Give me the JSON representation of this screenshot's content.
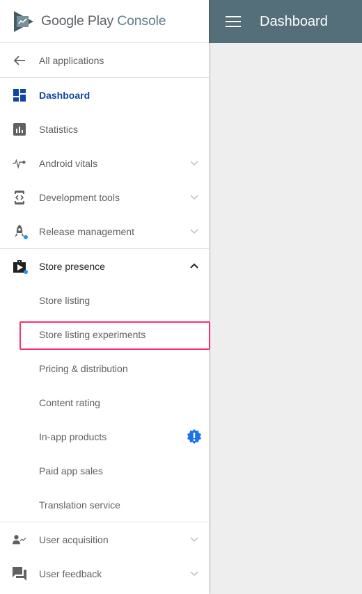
{
  "brand": {
    "google_play": "Google Play",
    "console": "Console"
  },
  "topbar": {
    "title": "Dashboard",
    "menu_icon": "hamburger-menu-icon"
  },
  "colors": {
    "topbar": "#546e7a",
    "active": "#0d47a1",
    "highlight_border": "#ff2d6b",
    "badge": "#1a73e8",
    "dot": "#2196f3"
  },
  "nav": {
    "back": {
      "label": "All applications",
      "icon": "arrow-left-icon"
    },
    "items": [
      {
        "label": "Dashboard",
        "icon": "dashboard-icon",
        "active": true
      },
      {
        "label": "Statistics",
        "icon": "bar-chart-icon"
      },
      {
        "label": "Android vitals",
        "icon": "pulse-icon",
        "expandable": true
      },
      {
        "label": "Development tools",
        "icon": "code-device-icon",
        "expandable": true
      },
      {
        "label": "Release management",
        "icon": "rocket-icon",
        "expandable": true,
        "dot": true
      },
      {
        "label": "Store presence",
        "icon": "briefcase-play-icon",
        "expandable": true,
        "expanded": true,
        "dot": true
      },
      {
        "label": "User acquisition",
        "icon": "user-trending-icon",
        "expandable": true
      },
      {
        "label": "User feedback",
        "icon": "chat-bubbles-icon",
        "expandable": true
      }
    ],
    "store_presence_children": [
      {
        "label": "Store listing"
      },
      {
        "label": "Store listing experiments",
        "highlighted": true
      },
      {
        "label": "Pricing & distribution"
      },
      {
        "label": "Content rating"
      },
      {
        "label": "In-app products",
        "badge": "!"
      },
      {
        "label": "Paid app sales"
      },
      {
        "label": "Translation service"
      }
    ]
  }
}
